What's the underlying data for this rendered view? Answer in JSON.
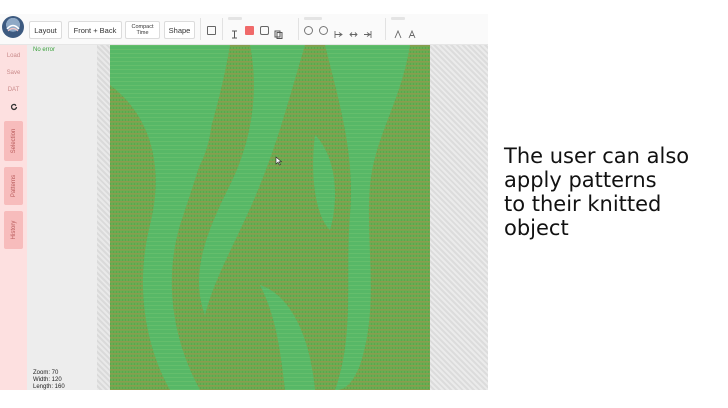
{
  "toolbar": {
    "layout_label": "Layout",
    "front_back_label": "Front + Back",
    "compact_time_line1": "Compact",
    "compact_time_line2": "Time",
    "shape_label": "Shape"
  },
  "sidebar": {
    "load_label": "Load",
    "save_label": "Save",
    "dat_label": "DAT",
    "selection_label": "Selection",
    "patterns_label": "Patterns",
    "history_label": "History"
  },
  "info": {
    "error_text": "No error",
    "zoom_text": "Zoom: 70",
    "width_text": "Width: 120",
    "length_text": "Length: 160"
  },
  "caption": {
    "line1": "The user can also",
    "line2": "apply patterns",
    "line3": "to their knitted",
    "line4": "object"
  },
  "colors": {
    "pattern_base": "#5bb561",
    "pattern_dark": "#7e9f4c",
    "sidebar_bg": "#fde0e0",
    "tab_bg": "#f7bcbc",
    "active_tool": "#f06a6a"
  },
  "icons": {
    "logo": "app-logo-icon",
    "refresh": "refresh-icon",
    "cursor": "mouse-cursor-icon"
  }
}
